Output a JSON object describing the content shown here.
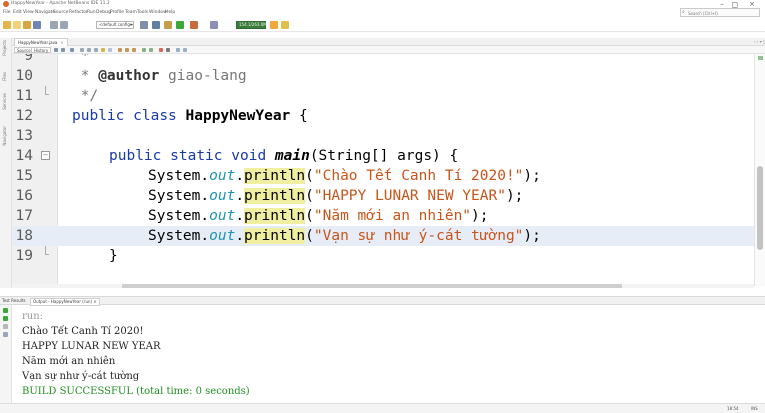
{
  "window": {
    "title": "HappyNewYear - Apache NetBeans IDE 11.2",
    "controls": {
      "minimize": "–",
      "maximize": "◻",
      "close": "×"
    }
  },
  "menu": [
    "File",
    "Edit",
    "View",
    "Navigate",
    "Source",
    "Refactor",
    "Run",
    "Debug",
    "Profile",
    "Team",
    "Tools",
    "Window",
    "Help"
  ],
  "search": {
    "placeholder": "Search (Ctrl+I)",
    "icon": "search-icon"
  },
  "toolbar": {
    "config_combo": "<default config>",
    "memory_label": "154.1/263.0MB"
  },
  "side_tabs": [
    "Projects",
    "Files",
    "Services",
    "Navigator"
  ],
  "editor_tab": {
    "label": "HappyNewYear.java",
    "close": "×"
  },
  "editor_subtabs": {
    "source": "Source",
    "history": "History"
  },
  "editor": {
    "lines": [
      {
        "n": "9"
      },
      {
        "n": "10"
      },
      {
        "n": "11"
      },
      {
        "n": "12"
      },
      {
        "n": "13"
      },
      {
        "n": "14"
      },
      {
        "n": "15"
      },
      {
        "n": "16"
      },
      {
        "n": "17"
      },
      {
        "n": "18"
      },
      {
        "n": "19"
      }
    ],
    "code": {
      "l9": " *",
      "l10_prefix": " * ",
      "l10_tag": "@author",
      "l10_rest": " giao-lang",
      "l11": " */",
      "kw_public": "public",
      "kw_class": "class",
      "class_name": "HappyNewYear",
      "brace_open": " {",
      "kw_static": "static",
      "kw_void": "void",
      "method_main": "main",
      "main_params": "(String[] args) {",
      "system": "System.",
      "out": "out",
      "dot": ".",
      "println": "println",
      "open_paren": "(",
      "close_paren": ");",
      "str1": "\"Chào Tết Canh Tí 2020!\"",
      "str2": "\"HAPPY LUNAR NEW YEAR\"",
      "str3": "\"Năm mới an nhiên\"",
      "str4": "\"Vạn sự như ý-cát tường\"",
      "l19": "}"
    },
    "current_line": "18"
  },
  "output_panel": {
    "tab_test_results": "Test Results",
    "tab_output": "Output - HappyNewYear (run)",
    "tab_close": "×",
    "lines": {
      "run": "run:",
      "out1": "Chào Tết Canh Tí 2020!",
      "out2": "HAPPY LUNAR NEW YEAR",
      "out3": "Năm mới an nhiên",
      "out4": "Vạn sự như ý-cát tường",
      "build": "BUILD SUCCESSFUL (total time: 0 seconds)"
    }
  },
  "status": {
    "position": "18:54",
    "mode": "INS"
  },
  "colors": {
    "keyword": "#1a3aa6",
    "string": "#c7551a",
    "field": "#1e94b0",
    "println_highlight": "#f0eea0",
    "current_line": "#e7edf7",
    "build_success": "#1f8f1f"
  }
}
